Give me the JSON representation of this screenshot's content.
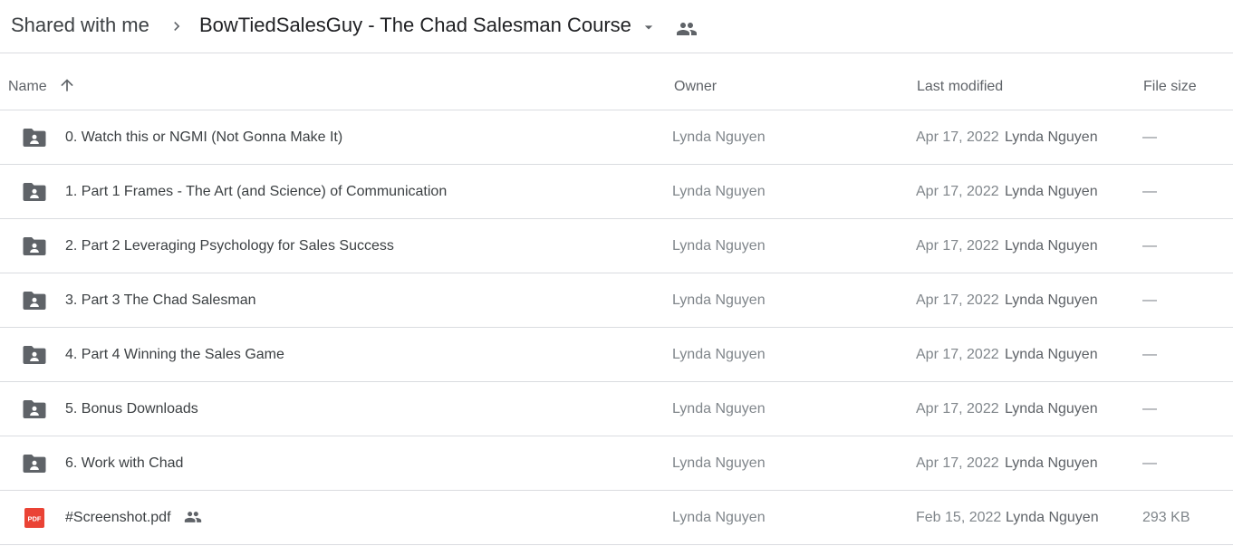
{
  "breadcrumb": {
    "root": "Shared with me",
    "current": "BowTiedSalesGuy - The Chad Salesman Course"
  },
  "icons": {
    "separator": "chevron-right-icon",
    "dropdown": "arrow-drop-down-icon",
    "shared": "people-icon",
    "sort": "arrow-upward-icon",
    "folder": "shared-folder-icon",
    "pdf": "pdf-icon"
  },
  "columns": {
    "name": "Name",
    "owner": "Owner",
    "modified": "Last modified",
    "size": "File size"
  },
  "colors": {
    "folder_icon": "#5f6368",
    "pdf_icon": "#ea4335",
    "divider": "#dadce0"
  },
  "files": [
    {
      "name": "0. Watch this or NGMI (Not Gonna Make It)",
      "owner": "Lynda Nguyen",
      "modified_date": "Apr 17, 2022",
      "modified_by": "Lynda Nguyen",
      "size": "—"
    },
    {
      "name": "1. Part 1 Frames - The Art (and Science) of Communication",
      "owner": "Lynda Nguyen",
      "modified_date": "Apr 17, 2022",
      "modified_by": "Lynda Nguyen",
      "size": "—"
    },
    {
      "name": "2. Part 2 Leveraging Psychology for Sales Success",
      "owner": "Lynda Nguyen",
      "modified_date": "Apr 17, 2022",
      "modified_by": "Lynda Nguyen",
      "size": "—"
    },
    {
      "name": "3. Part 3 The Chad Salesman",
      "owner": "Lynda Nguyen",
      "modified_date": "Apr 17, 2022",
      "modified_by": "Lynda Nguyen",
      "size": "—"
    },
    {
      "name": "4. Part 4 Winning the Sales Game",
      "owner": "Lynda Nguyen",
      "modified_date": "Apr 17, 2022",
      "modified_by": "Lynda Nguyen",
      "size": "—"
    },
    {
      "name": "5. Bonus Downloads",
      "owner": "Lynda Nguyen",
      "modified_date": "Apr 17, 2022",
      "modified_by": "Lynda Nguyen",
      "size": "—"
    },
    {
      "name": "6. Work with Chad",
      "owner": "Lynda Nguyen",
      "modified_date": "Apr 17, 2022",
      "modified_by": "Lynda Nguyen",
      "size": "—"
    },
    {
      "name": "#Screenshot.pdf",
      "owner": "Lynda Nguyen",
      "modified_date": "Feb 15, 2022",
      "modified_by": "Lynda Nguyen",
      "size": "293 KB"
    }
  ]
}
